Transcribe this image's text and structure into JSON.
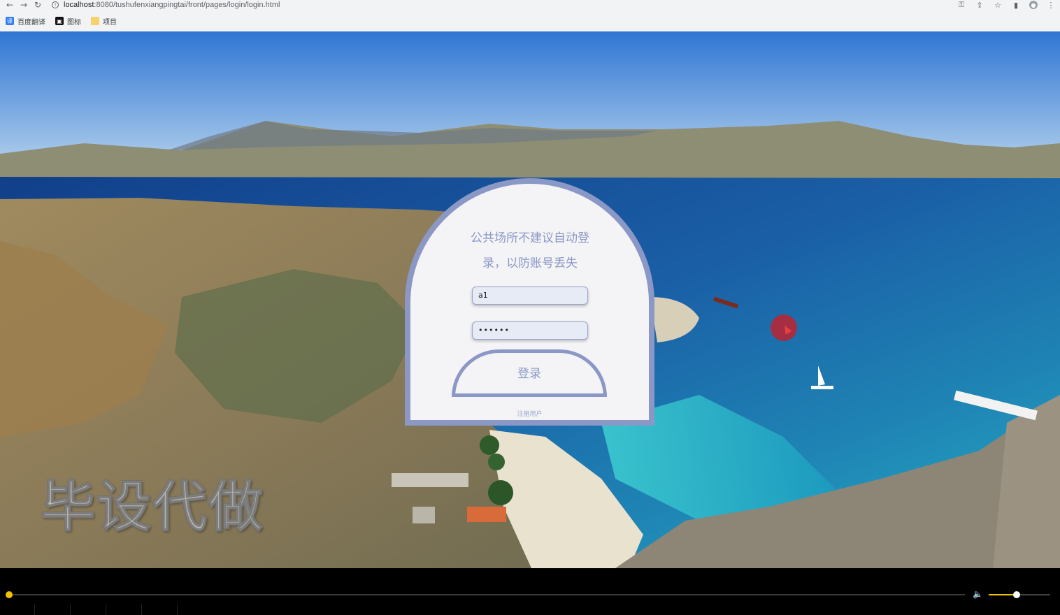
{
  "browser": {
    "url_host": "localhost",
    "url_path": ":8080/tushufenxiangpingtai/front/pages/login/login.html",
    "nav": {
      "back": "←",
      "forward": "→",
      "reload": "↻"
    },
    "icons": [
      "key-icon",
      "share-icon",
      "star-icon",
      "sidebar-icon",
      "avatar-icon",
      "menu-icon"
    ],
    "bookmarks": [
      {
        "label": "百度翻译",
        "icon": "baidu-translate-icon"
      },
      {
        "label": "图标",
        "icon": "iconfont-icon"
      },
      {
        "label": "项目",
        "icon": "folder-icon"
      }
    ]
  },
  "page": {
    "watermark": "毕设代做",
    "login": {
      "tip_line1": "公共场所不建议自动登",
      "tip_line2": "录，以防账号丢失",
      "username_value": "a1",
      "password_value": "••••••",
      "login_button": "登录",
      "register_link": "注册用户"
    }
  },
  "player": {
    "progress": 0.0,
    "volume": 0.45
  },
  "colors": {
    "accent": "#8b98c6",
    "card_bg": "#f4f4f6",
    "player_accent": "#f2c200"
  }
}
